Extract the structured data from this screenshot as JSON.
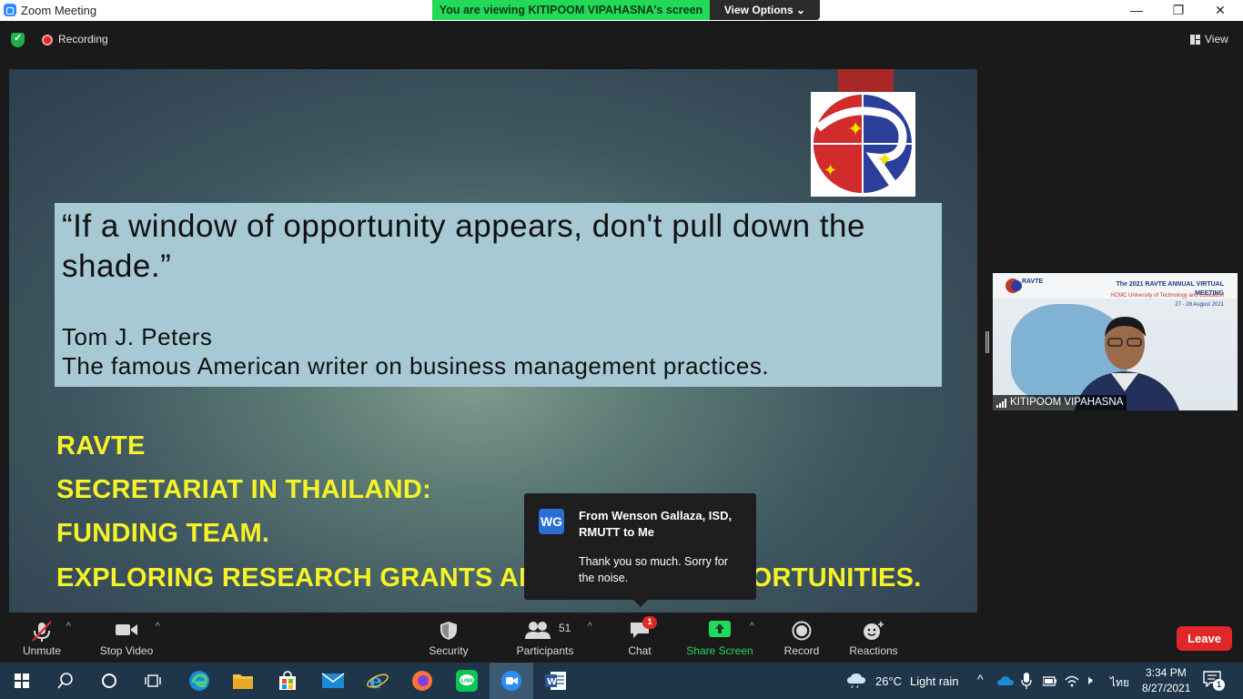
{
  "window": {
    "title": "Zoom Meeting",
    "viewing_banner": "You are viewing KITIPOOM VIPAHASNA's screen",
    "view_options": "View Options",
    "minimize": "—",
    "maximize": "❐",
    "close": "✕"
  },
  "topbar": {
    "recording": "Recording",
    "view": "View"
  },
  "slide": {
    "quote": "“If a window of opportunity appears, don't pull down the shade.”",
    "author": "Tom J. Peters",
    "author_desc": "The famous American writer on business management practices.",
    "lines": [
      "RAVTE",
      "SECRETARIAT IN THAILAND:",
      "FUNDING TEAM.",
      "EXPLORING RESEARCH GRANTS AND FUNDING OPPORTUNITIES."
    ]
  },
  "chat_toast": {
    "avatar_initials": "WG",
    "from": "From Wenson Gallaza, ISD, RMUTT to Me",
    "message": "Thank you so much. Sorry for the noise."
  },
  "participant_tile": {
    "event_title": "The 2021 RAVTE ANNUAL VIRTUAL MEETING",
    "event_host": "HCMC University of Technology and Education",
    "event_dates": "27 - 28 August 2021",
    "logo_text": "RAVTE",
    "name": "KITIPOOM VIPAHASNA"
  },
  "toolbar": {
    "unmute": "Unmute",
    "stop_video": "Stop Video",
    "security": "Security",
    "participants": "Participants",
    "participants_count": "51",
    "chat": "Chat",
    "chat_badge": "1",
    "share_screen": "Share Screen",
    "record": "Record",
    "reactions": "Reactions",
    "leave": "Leave"
  },
  "taskbar": {
    "weather_temp": "26°C",
    "weather_desc": "Light rain",
    "language": "ไทย",
    "time": "3:34 PM",
    "date": "8/27/2021",
    "notifications_count": "1"
  },
  "colors": {
    "share_green": "#23d959",
    "leave_red": "#e02828",
    "slide_yellow": "#f5f227",
    "quote_box": "#a6c9d3"
  }
}
